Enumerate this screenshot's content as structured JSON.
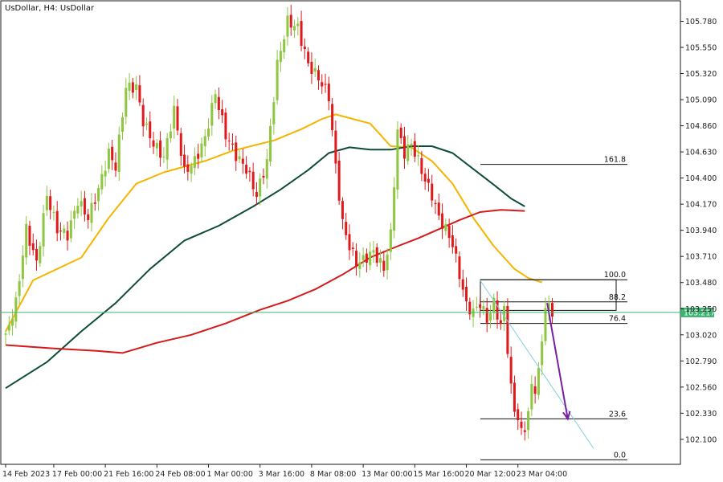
{
  "chart_data": {
    "type": "candlestick",
    "title": "UsDollar, H4:  UsDollar",
    "ylim": [
      101.88,
      105.96
    ],
    "y_ticks": [
      "105.780",
      "105.550",
      "105.320",
      "105.090",
      "104.860",
      "104.630",
      "104.400",
      "104.170",
      "103.940",
      "103.710",
      "103.480",
      "103.250",
      "103.020",
      "102.790",
      "102.560",
      "102.330",
      "102.100"
    ],
    "x_tick_labels": [
      "14 Feb 2023",
      "17 Feb 00:00",
      "21 Feb 16:00",
      "24 Feb 08:00",
      "1 Mar 00:00",
      "3 Mar 16:00",
      "8 Mar 08:00",
      "13 Mar 00:00",
      "15 Mar 16:00",
      "20 Mar 12:00",
      "23 Mar 04:00"
    ],
    "current_price": {
      "label": "103.217",
      "value": 103.217,
      "color": "#3cb371"
    },
    "bull_color": "#8dc63f",
    "bear_color": "#e0191b",
    "candle_anchors": [
      [
        0,
        103.0
      ],
      [
        3,
        103.3
      ],
      [
        6,
        103.95
      ],
      [
        9,
        103.65
      ],
      [
        12,
        104.25
      ],
      [
        15,
        103.95
      ],
      [
        18,
        103.9
      ],
      [
        21,
        104.2
      ],
      [
        24,
        104.05
      ],
      [
        27,
        104.3
      ],
      [
        30,
        104.62
      ],
      [
        32,
        104.5
      ],
      [
        35,
        105.2
      ],
      [
        38,
        105.2
      ],
      [
        40,
        104.9
      ],
      [
        43,
        104.7
      ],
      [
        46,
        104.58
      ],
      [
        49,
        105.0
      ],
      [
        52,
        104.45
      ],
      [
        55,
        104.55
      ],
      [
        58,
        104.75
      ],
      [
        61,
        105.15
      ],
      [
        64,
        104.78
      ],
      [
        67,
        104.6
      ],
      [
        70,
        104.48
      ],
      [
        73,
        104.25
      ],
      [
        76,
        104.55
      ],
      [
        79,
        105.4
      ],
      [
        82,
        105.78
      ],
      [
        85,
        105.72
      ],
      [
        88,
        105.4
      ],
      [
        91,
        105.28
      ],
      [
        94,
        105.12
      ],
      [
        96,
        104.5
      ],
      [
        98,
        104.0
      ],
      [
        100,
        103.8
      ],
      [
        102,
        103.65
      ],
      [
        104,
        103.68
      ],
      [
        107,
        103.75
      ],
      [
        110,
        103.6
      ],
      [
        112,
        103.9
      ],
      [
        114,
        104.82
      ],
      [
        116,
        104.62
      ],
      [
        118,
        104.7
      ],
      [
        120,
        104.55
      ],
      [
        122,
        104.38
      ],
      [
        124,
        104.25
      ],
      [
        126,
        104.05
      ],
      [
        128,
        103.95
      ],
      [
        130,
        103.82
      ],
      [
        132,
        103.55
      ],
      [
        134,
        103.28
      ],
      [
        136,
        103.22
      ],
      [
        138,
        103.3
      ],
      [
        140,
        103.15
      ],
      [
        142,
        103.3
      ],
      [
        144,
        103.1
      ],
      [
        145,
        103.25
      ],
      [
        147,
        102.55
      ],
      [
        148,
        102.35
      ],
      [
        149,
        102.3
      ],
      [
        150,
        102.15
      ],
      [
        151,
        102.2
      ],
      [
        152,
        102.35
      ],
      [
        153,
        102.55
      ],
      [
        154,
        102.55
      ],
      [
        155,
        102.7
      ],
      [
        156,
        102.95
      ],
      [
        157,
        103.3
      ],
      [
        158,
        103.25
      ],
      [
        159,
        103.2
      ]
    ],
    "moving_averages": [
      {
        "color": "#f5b400",
        "points": [
          [
            0,
            103.05
          ],
          [
            8,
            103.5
          ],
          [
            22,
            103.7
          ],
          [
            30,
            104.05
          ],
          [
            38,
            104.35
          ],
          [
            46,
            104.45
          ],
          [
            58,
            104.55
          ],
          [
            66,
            104.64
          ],
          [
            78,
            104.73
          ],
          [
            86,
            104.83
          ],
          [
            92,
            104.92
          ],
          [
            96,
            104.96
          ],
          [
            101,
            104.92
          ],
          [
            106,
            104.88
          ],
          [
            112,
            104.68
          ],
          [
            118,
            104.67
          ],
          [
            124,
            104.55
          ],
          [
            130,
            104.35
          ],
          [
            136,
            104.05
          ],
          [
            142,
            103.8
          ],
          [
            148,
            103.6
          ],
          [
            152,
            103.52
          ],
          [
            156,
            103.48
          ]
        ]
      },
      {
        "color": "#0f4b3c",
        "points": [
          [
            0,
            102.55
          ],
          [
            12,
            102.78
          ],
          [
            22,
            103.05
          ],
          [
            32,
            103.3
          ],
          [
            42,
            103.6
          ],
          [
            52,
            103.85
          ],
          [
            62,
            103.98
          ],
          [
            72,
            104.15
          ],
          [
            80,
            104.3
          ],
          [
            88,
            104.47
          ],
          [
            94,
            104.62
          ],
          [
            100,
            104.67
          ],
          [
            106,
            104.65
          ],
          [
            112,
            104.65
          ],
          [
            118,
            104.68
          ],
          [
            124,
            104.68
          ],
          [
            130,
            104.62
          ],
          [
            136,
            104.48
          ],
          [
            142,
            104.34
          ],
          [
            147,
            104.22
          ],
          [
            151,
            104.15
          ]
        ]
      },
      {
        "color": "#d51a1a",
        "points": [
          [
            0,
            102.93
          ],
          [
            14,
            102.9
          ],
          [
            26,
            102.88
          ],
          [
            34,
            102.86
          ],
          [
            44,
            102.95
          ],
          [
            54,
            103.02
          ],
          [
            64,
            103.12
          ],
          [
            74,
            103.24
          ],
          [
            82,
            103.32
          ],
          [
            90,
            103.42
          ],
          [
            98,
            103.55
          ],
          [
            106,
            103.7
          ],
          [
            114,
            103.8
          ],
          [
            120,
            103.87
          ],
          [
            126,
            103.95
          ],
          [
            132,
            104.03
          ],
          [
            138,
            104.1
          ],
          [
            144,
            104.12
          ],
          [
            151,
            104.11
          ]
        ]
      }
    ],
    "fibonacci": {
      "levels": [
        {
          "label": "161.8",
          "value": 104.52
        },
        {
          "label": "100.0",
          "value": 103.505
        },
        {
          "label": "88.2",
          "value": 103.31
        },
        {
          "label": "76.4",
          "value": 103.12
        },
        {
          "label": "23.6",
          "value": 102.28
        },
        {
          "label": "0.0",
          "value": 101.92
        }
      ],
      "box_top": 103.505,
      "box_bottom": 103.235
    },
    "trendline_points": [
      [
        138,
        103.5
      ],
      [
        171,
        102.02
      ]
    ],
    "projection_arrow": {
      "color": "#7b1fa2",
      "from": [
        157.5,
        103.3
      ],
      "to": [
        163.5,
        102.28
      ]
    }
  }
}
